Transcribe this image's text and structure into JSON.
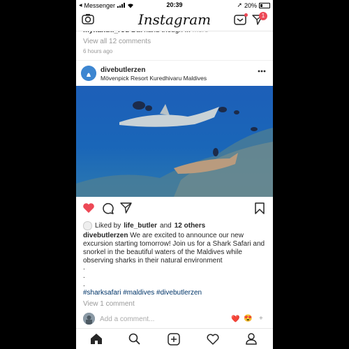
{
  "status_bar": {
    "carrier": "Messenger",
    "time": "20:39",
    "battery": "20%"
  },
  "header": {
    "logo": "Instagram",
    "direct_badge": "1",
    "icons": [
      "camera-icon",
      "igtv-icon",
      "direct-message-icon"
    ]
  },
  "previous_post": {
    "comment_user": "mynanthi_rou",
    "comment_text": "Dat hand though ...",
    "more": "more",
    "view_all": "View all 12 comments",
    "time_ago": "6 hours ago"
  },
  "post": {
    "username": "divebutlerzen",
    "location": "Mövenpick Resort Kuredhivaru Maldives",
    "liked": true,
    "likes_prefix": "Liked by",
    "likes_user": "life_butler",
    "likes_connector": "and",
    "likes_others": "12 others",
    "caption_user": "divebutlerzen",
    "caption_text": "We are excited to announce our new excursion starting tomorrow! Join us for a Shark Safari and snorkel in the beautiful waters of the Maldives while observing sharks in their natural environment",
    "caption_dots": [
      ".",
      ".",
      "."
    ],
    "hashtags": "#sharksafari #maldives #divebutlerzen",
    "view_comments": "View 1 comment",
    "add_comment_placeholder": "Add a comment...",
    "quick_reactions": [
      "❤️",
      "😍",
      "+"
    ]
  },
  "tab_bar": {
    "items": [
      "home-icon",
      "search-icon",
      "new-post-icon",
      "activity-icon",
      "profile-icon"
    ]
  },
  "colors": {
    "like_red": "#ed4956",
    "hashtag_blue": "#003569",
    "muted_gray": "#999999"
  }
}
